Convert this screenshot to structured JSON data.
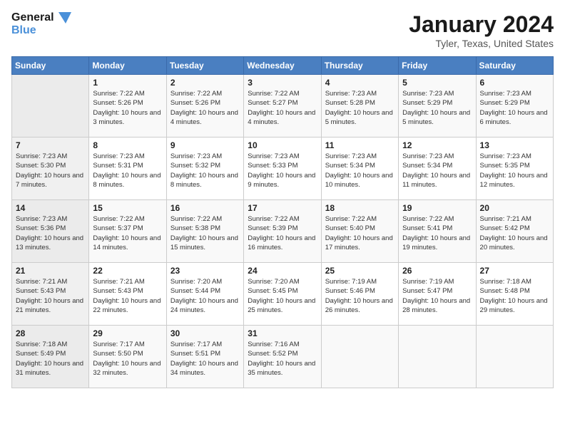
{
  "logo": {
    "line1": "General",
    "line2": "Blue"
  },
  "title": "January 2024",
  "subtitle": "Tyler, Texas, United States",
  "headers": [
    "Sunday",
    "Monday",
    "Tuesday",
    "Wednesday",
    "Thursday",
    "Friday",
    "Saturday"
  ],
  "weeks": [
    [
      {
        "num": "",
        "sunrise": "",
        "sunset": "",
        "daylight": ""
      },
      {
        "num": "1",
        "sunrise": "Sunrise: 7:22 AM",
        "sunset": "Sunset: 5:26 PM",
        "daylight": "Daylight: 10 hours and 3 minutes."
      },
      {
        "num": "2",
        "sunrise": "Sunrise: 7:22 AM",
        "sunset": "Sunset: 5:26 PM",
        "daylight": "Daylight: 10 hours and 4 minutes."
      },
      {
        "num": "3",
        "sunrise": "Sunrise: 7:22 AM",
        "sunset": "Sunset: 5:27 PM",
        "daylight": "Daylight: 10 hours and 4 minutes."
      },
      {
        "num": "4",
        "sunrise": "Sunrise: 7:23 AM",
        "sunset": "Sunset: 5:28 PM",
        "daylight": "Daylight: 10 hours and 5 minutes."
      },
      {
        "num": "5",
        "sunrise": "Sunrise: 7:23 AM",
        "sunset": "Sunset: 5:29 PM",
        "daylight": "Daylight: 10 hours and 5 minutes."
      },
      {
        "num": "6",
        "sunrise": "Sunrise: 7:23 AM",
        "sunset": "Sunset: 5:29 PM",
        "daylight": "Daylight: 10 hours and 6 minutes."
      }
    ],
    [
      {
        "num": "7",
        "sunrise": "Sunrise: 7:23 AM",
        "sunset": "Sunset: 5:30 PM",
        "daylight": "Daylight: 10 hours and 7 minutes."
      },
      {
        "num": "8",
        "sunrise": "Sunrise: 7:23 AM",
        "sunset": "Sunset: 5:31 PM",
        "daylight": "Daylight: 10 hours and 8 minutes."
      },
      {
        "num": "9",
        "sunrise": "Sunrise: 7:23 AM",
        "sunset": "Sunset: 5:32 PM",
        "daylight": "Daylight: 10 hours and 8 minutes."
      },
      {
        "num": "10",
        "sunrise": "Sunrise: 7:23 AM",
        "sunset": "Sunset: 5:33 PM",
        "daylight": "Daylight: 10 hours and 9 minutes."
      },
      {
        "num": "11",
        "sunrise": "Sunrise: 7:23 AM",
        "sunset": "Sunset: 5:34 PM",
        "daylight": "Daylight: 10 hours and 10 minutes."
      },
      {
        "num": "12",
        "sunrise": "Sunrise: 7:23 AM",
        "sunset": "Sunset: 5:34 PM",
        "daylight": "Daylight: 10 hours and 11 minutes."
      },
      {
        "num": "13",
        "sunrise": "Sunrise: 7:23 AM",
        "sunset": "Sunset: 5:35 PM",
        "daylight": "Daylight: 10 hours and 12 minutes."
      }
    ],
    [
      {
        "num": "14",
        "sunrise": "Sunrise: 7:23 AM",
        "sunset": "Sunset: 5:36 PM",
        "daylight": "Daylight: 10 hours and 13 minutes."
      },
      {
        "num": "15",
        "sunrise": "Sunrise: 7:22 AM",
        "sunset": "Sunset: 5:37 PM",
        "daylight": "Daylight: 10 hours and 14 minutes."
      },
      {
        "num": "16",
        "sunrise": "Sunrise: 7:22 AM",
        "sunset": "Sunset: 5:38 PM",
        "daylight": "Daylight: 10 hours and 15 minutes."
      },
      {
        "num": "17",
        "sunrise": "Sunrise: 7:22 AM",
        "sunset": "Sunset: 5:39 PM",
        "daylight": "Daylight: 10 hours and 16 minutes."
      },
      {
        "num": "18",
        "sunrise": "Sunrise: 7:22 AM",
        "sunset": "Sunset: 5:40 PM",
        "daylight": "Daylight: 10 hours and 17 minutes."
      },
      {
        "num": "19",
        "sunrise": "Sunrise: 7:22 AM",
        "sunset": "Sunset: 5:41 PM",
        "daylight": "Daylight: 10 hours and 19 minutes."
      },
      {
        "num": "20",
        "sunrise": "Sunrise: 7:21 AM",
        "sunset": "Sunset: 5:42 PM",
        "daylight": "Daylight: 10 hours and 20 minutes."
      }
    ],
    [
      {
        "num": "21",
        "sunrise": "Sunrise: 7:21 AM",
        "sunset": "Sunset: 5:43 PM",
        "daylight": "Daylight: 10 hours and 21 minutes."
      },
      {
        "num": "22",
        "sunrise": "Sunrise: 7:21 AM",
        "sunset": "Sunset: 5:43 PM",
        "daylight": "Daylight: 10 hours and 22 minutes."
      },
      {
        "num": "23",
        "sunrise": "Sunrise: 7:20 AM",
        "sunset": "Sunset: 5:44 PM",
        "daylight": "Daylight: 10 hours and 24 minutes."
      },
      {
        "num": "24",
        "sunrise": "Sunrise: 7:20 AM",
        "sunset": "Sunset: 5:45 PM",
        "daylight": "Daylight: 10 hours and 25 minutes."
      },
      {
        "num": "25",
        "sunrise": "Sunrise: 7:19 AM",
        "sunset": "Sunset: 5:46 PM",
        "daylight": "Daylight: 10 hours and 26 minutes."
      },
      {
        "num": "26",
        "sunrise": "Sunrise: 7:19 AM",
        "sunset": "Sunset: 5:47 PM",
        "daylight": "Daylight: 10 hours and 28 minutes."
      },
      {
        "num": "27",
        "sunrise": "Sunrise: 7:18 AM",
        "sunset": "Sunset: 5:48 PM",
        "daylight": "Daylight: 10 hours and 29 minutes."
      }
    ],
    [
      {
        "num": "28",
        "sunrise": "Sunrise: 7:18 AM",
        "sunset": "Sunset: 5:49 PM",
        "daylight": "Daylight: 10 hours and 31 minutes."
      },
      {
        "num": "29",
        "sunrise": "Sunrise: 7:17 AM",
        "sunset": "Sunset: 5:50 PM",
        "daylight": "Daylight: 10 hours and 32 minutes."
      },
      {
        "num": "30",
        "sunrise": "Sunrise: 7:17 AM",
        "sunset": "Sunset: 5:51 PM",
        "daylight": "Daylight: 10 hours and 34 minutes."
      },
      {
        "num": "31",
        "sunrise": "Sunrise: 7:16 AM",
        "sunset": "Sunset: 5:52 PM",
        "daylight": "Daylight: 10 hours and 35 minutes."
      },
      {
        "num": "",
        "sunrise": "",
        "sunset": "",
        "daylight": ""
      },
      {
        "num": "",
        "sunrise": "",
        "sunset": "",
        "daylight": ""
      },
      {
        "num": "",
        "sunrise": "",
        "sunset": "",
        "daylight": ""
      }
    ]
  ]
}
